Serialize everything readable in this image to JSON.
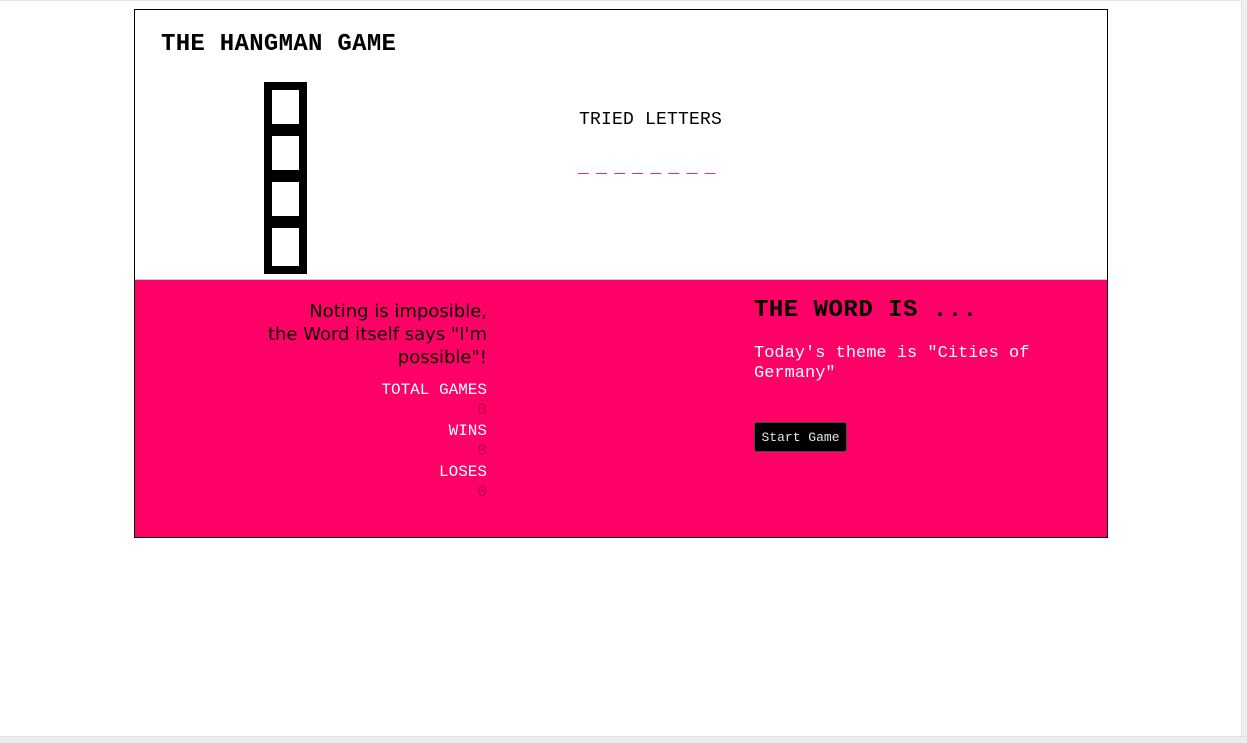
{
  "game": {
    "title": "THE HANGMAN GAME",
    "tried_letters_label": "TRIED LETTERS",
    "word_blanks": [
      "_",
      "_",
      "_",
      "_",
      "_",
      "_",
      "_",
      "_"
    ],
    "quote_lines": [
      "Noting is imposible,",
      "the Word itself says \"I'm possible\"!"
    ],
    "stats": {
      "total_games_label": "TOTAL GAMES",
      "total_games": "0",
      "wins_label": "WINS",
      "wins": "0",
      "loses_label": "LOSES",
      "loses": "0"
    },
    "word_heading": "THE WORD IS ...",
    "theme_text": "Today's theme is \"Cities of Germany\"",
    "start_button": "Start Game",
    "hangman_stage_boxes": 4
  },
  "colors": {
    "accent": "#ff0066",
    "background": "#ffffff",
    "button": "#000000"
  },
  "icons": {
    "tower": "hangman-tower-icon"
  }
}
